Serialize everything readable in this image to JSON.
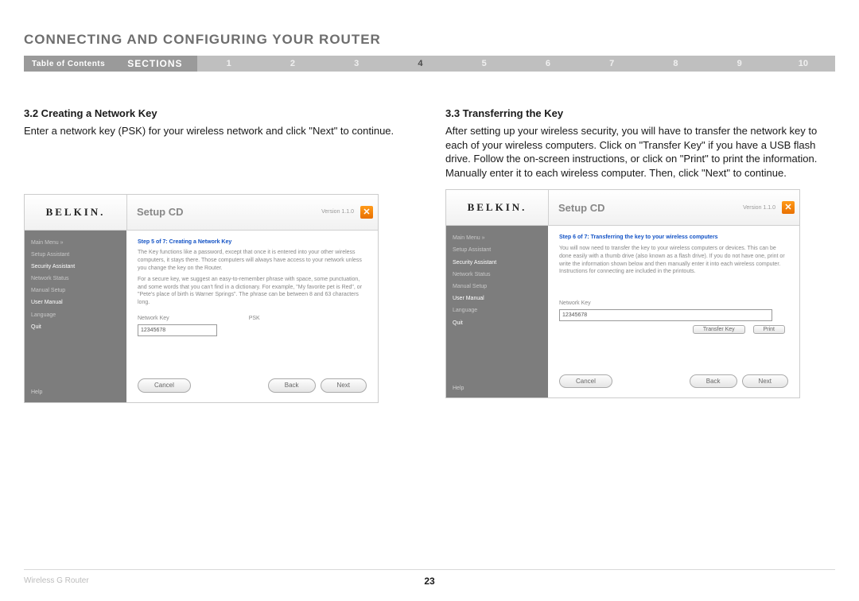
{
  "header": {
    "title": "CONNECTING AND CONFIGURING YOUR ROUTER"
  },
  "nav": {
    "toc": "Table of Contents",
    "label": "SECTIONS",
    "items": [
      "1",
      "2",
      "3",
      "4",
      "5",
      "6",
      "7",
      "8",
      "9",
      "10"
    ],
    "active": "4"
  },
  "left": {
    "heading": "3.2 Creating a Network Key",
    "body": "Enter a network key (PSK) for your wireless network and click \"Next\" to continue."
  },
  "right": {
    "heading": "3.3 Transferring the Key",
    "body": "After setting up your wireless security, you will have to transfer the network key to each of your wireless computers. Click on \"Transfer Key\" if you have a USB flash drive. Follow the on-screen instructions, or click on \"Print\" to print the information. Manually enter it to each wireless computer. Then, click \"Next\" to continue."
  },
  "app_common": {
    "brand": "BELKIN.",
    "title": "Setup CD",
    "version": "Version 1.1.0",
    "close": "✕",
    "sidebar": {
      "main": "Main Menu  »",
      "setup_assistant": "Setup Assistant",
      "security_assistant": "Security Assistant",
      "network_status": "Network Status",
      "manual_setup": "Manual Setup",
      "user_manual": "User Manual",
      "language": "Language",
      "quit": "Quit",
      "help": "Help"
    },
    "buttons": {
      "cancel": "Cancel",
      "back": "Back",
      "next": "Next",
      "transfer": "Transfer Key",
      "print": "Print"
    }
  },
  "app1": {
    "step": "Step 5 of 7: Creating a Network Key",
    "p1": "The Key functions like a password, except that once it is entered into your other wireless computers, it stays there. Those computers will always have access to your network unless you change the key on the Router.",
    "p2": "For a secure key, we suggest an easy-to-remember phrase with space, some punctuation, and some words that you can't find in a dictionary. For example, \"My favorite pet is Red\", or \"Pete's place of birth is Warner Springs\". The phrase can be between 8 and 63 characters long.",
    "label_key": "Network Key",
    "label_psk": "PSK",
    "value": "12345678"
  },
  "app2": {
    "step": "Step 6 of 7: Transferring the key to your wireless computers",
    "p1": "You will now need to transfer the key to your wireless computers or devices. This can be done easily with a thumb drive (also known as a flash drive). If you do not have one, print or write the information shown below and then manually enter it into each wireless computer. Instructions for connecting are included in the printouts.",
    "label_key": "Network Key",
    "value": "12345678"
  },
  "footer": {
    "product": "Wireless G Router",
    "page": "23"
  }
}
